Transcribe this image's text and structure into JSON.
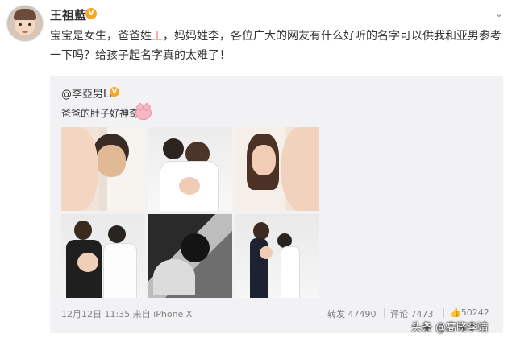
{
  "post": {
    "username": "王祖藍",
    "verified_badge": "V",
    "text_part1": "宝宝是女生，爸爸姓",
    "text_highlight": "王",
    "text_part2": "，妈妈姓李，各位广大的网友有什么好听的名字可以供我和亚男参考一下吗？给孩子起名字真的太难了！",
    "menu_icon": "chevron-down-icon"
  },
  "repost": {
    "username": "@李亞男LL",
    "verified_badge": "V",
    "text": "爸爸的肚子好神奇",
    "emoji": "pig-face-icon",
    "photos": [
      "photo-1",
      "photo-2",
      "photo-3",
      "photo-4",
      "photo-5",
      "photo-6"
    ],
    "time": "12月12日 11:35 来自 iPhone X",
    "repost_label": "转发 47490",
    "comment_label": "评论 7473",
    "like_label": "50242"
  },
  "watermark": "头条 @高晓李靖",
  "colors": {
    "highlight": "#eb7350",
    "badge": "#f5a623",
    "repost_bg": "#f2f2f5",
    "meta": "#808080"
  }
}
